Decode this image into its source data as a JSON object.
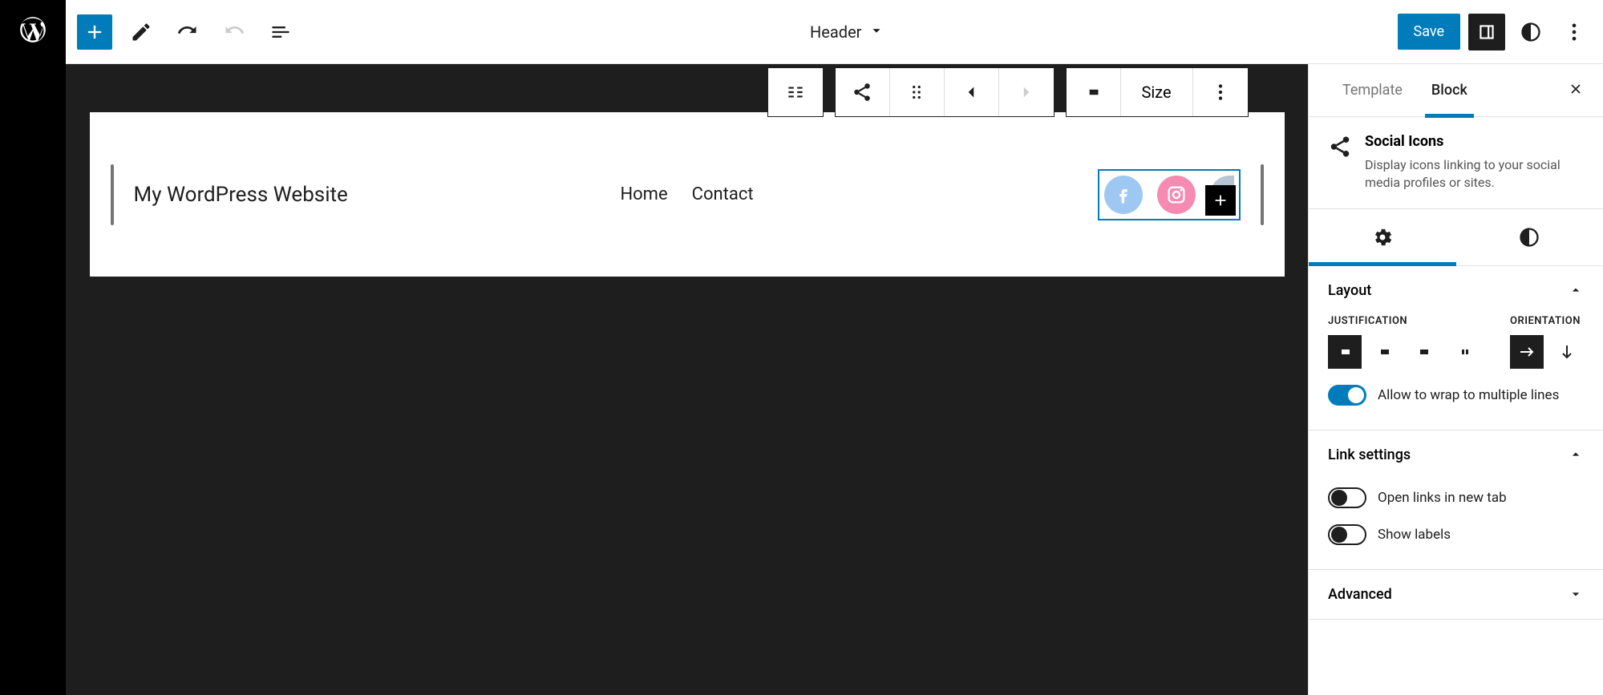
{
  "topbar": {
    "document_title": "Header",
    "save_label": "Save"
  },
  "header_block": {
    "site_title": "My WordPress Website",
    "nav": [
      "Home",
      "Contact"
    ]
  },
  "floating_toolbar": {
    "size_label": "Size"
  },
  "sidebar": {
    "tabs": {
      "template": "Template",
      "block": "Block"
    },
    "block_info": {
      "title": "Social Icons",
      "description": "Display icons linking to your social media profiles or sites."
    },
    "layout": {
      "title": "Layout",
      "justification_label": "JUSTIFICATION",
      "orientation_label": "ORIENTATION",
      "wrap_label": "Allow to wrap to multiple lines",
      "wrap_on": true
    },
    "link_settings": {
      "title": "Link settings",
      "new_tab_label": "Open links in new tab",
      "new_tab_on": false,
      "show_labels_label": "Show labels",
      "show_labels_on": false
    },
    "advanced": {
      "title": "Advanced"
    }
  }
}
